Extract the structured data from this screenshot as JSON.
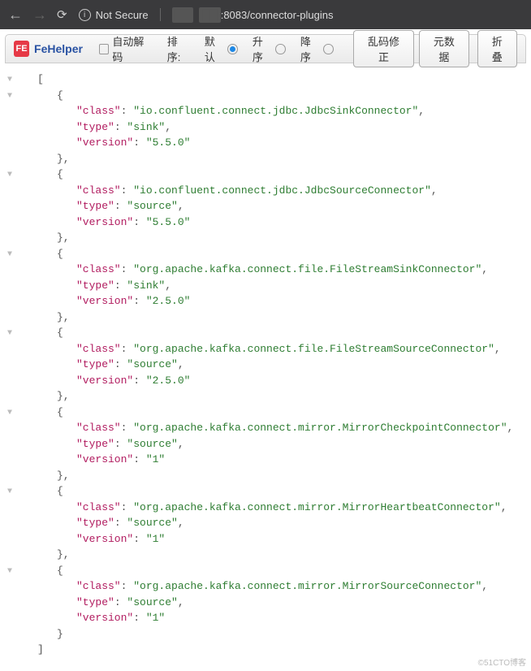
{
  "browser": {
    "security_label": "Not Secure",
    "url_suffix": ":8083/connector-plugins"
  },
  "toolbar": {
    "brand": "FeHelper",
    "auto_decode": "自动解码",
    "sort_label": "排序:",
    "sort_default": "默认",
    "sort_asc": "升序",
    "sort_desc": "降序",
    "btn_fix": "乱码修正",
    "btn_meta": "元数据",
    "btn_fold": "折叠"
  },
  "json": [
    {
      "class": "io.confluent.connect.jdbc.JdbcSinkConnector",
      "type": "sink",
      "version": "5.5.0"
    },
    {
      "class": "io.confluent.connect.jdbc.JdbcSourceConnector",
      "type": "source",
      "version": "5.5.0"
    },
    {
      "class": "org.apache.kafka.connect.file.FileStreamSinkConnector",
      "type": "sink",
      "version": "2.5.0"
    },
    {
      "class": "org.apache.kafka.connect.file.FileStreamSourceConnector",
      "type": "source",
      "version": "2.5.0"
    },
    {
      "class": "org.apache.kafka.connect.mirror.MirrorCheckpointConnector",
      "type": "source",
      "version": "1"
    },
    {
      "class": "org.apache.kafka.connect.mirror.MirrorHeartbeatConnector",
      "type": "source",
      "version": "1"
    },
    {
      "class": "org.apache.kafka.connect.mirror.MirrorSourceConnector",
      "type": "source",
      "version": "1"
    }
  ],
  "watermark": "©51CTO博客"
}
